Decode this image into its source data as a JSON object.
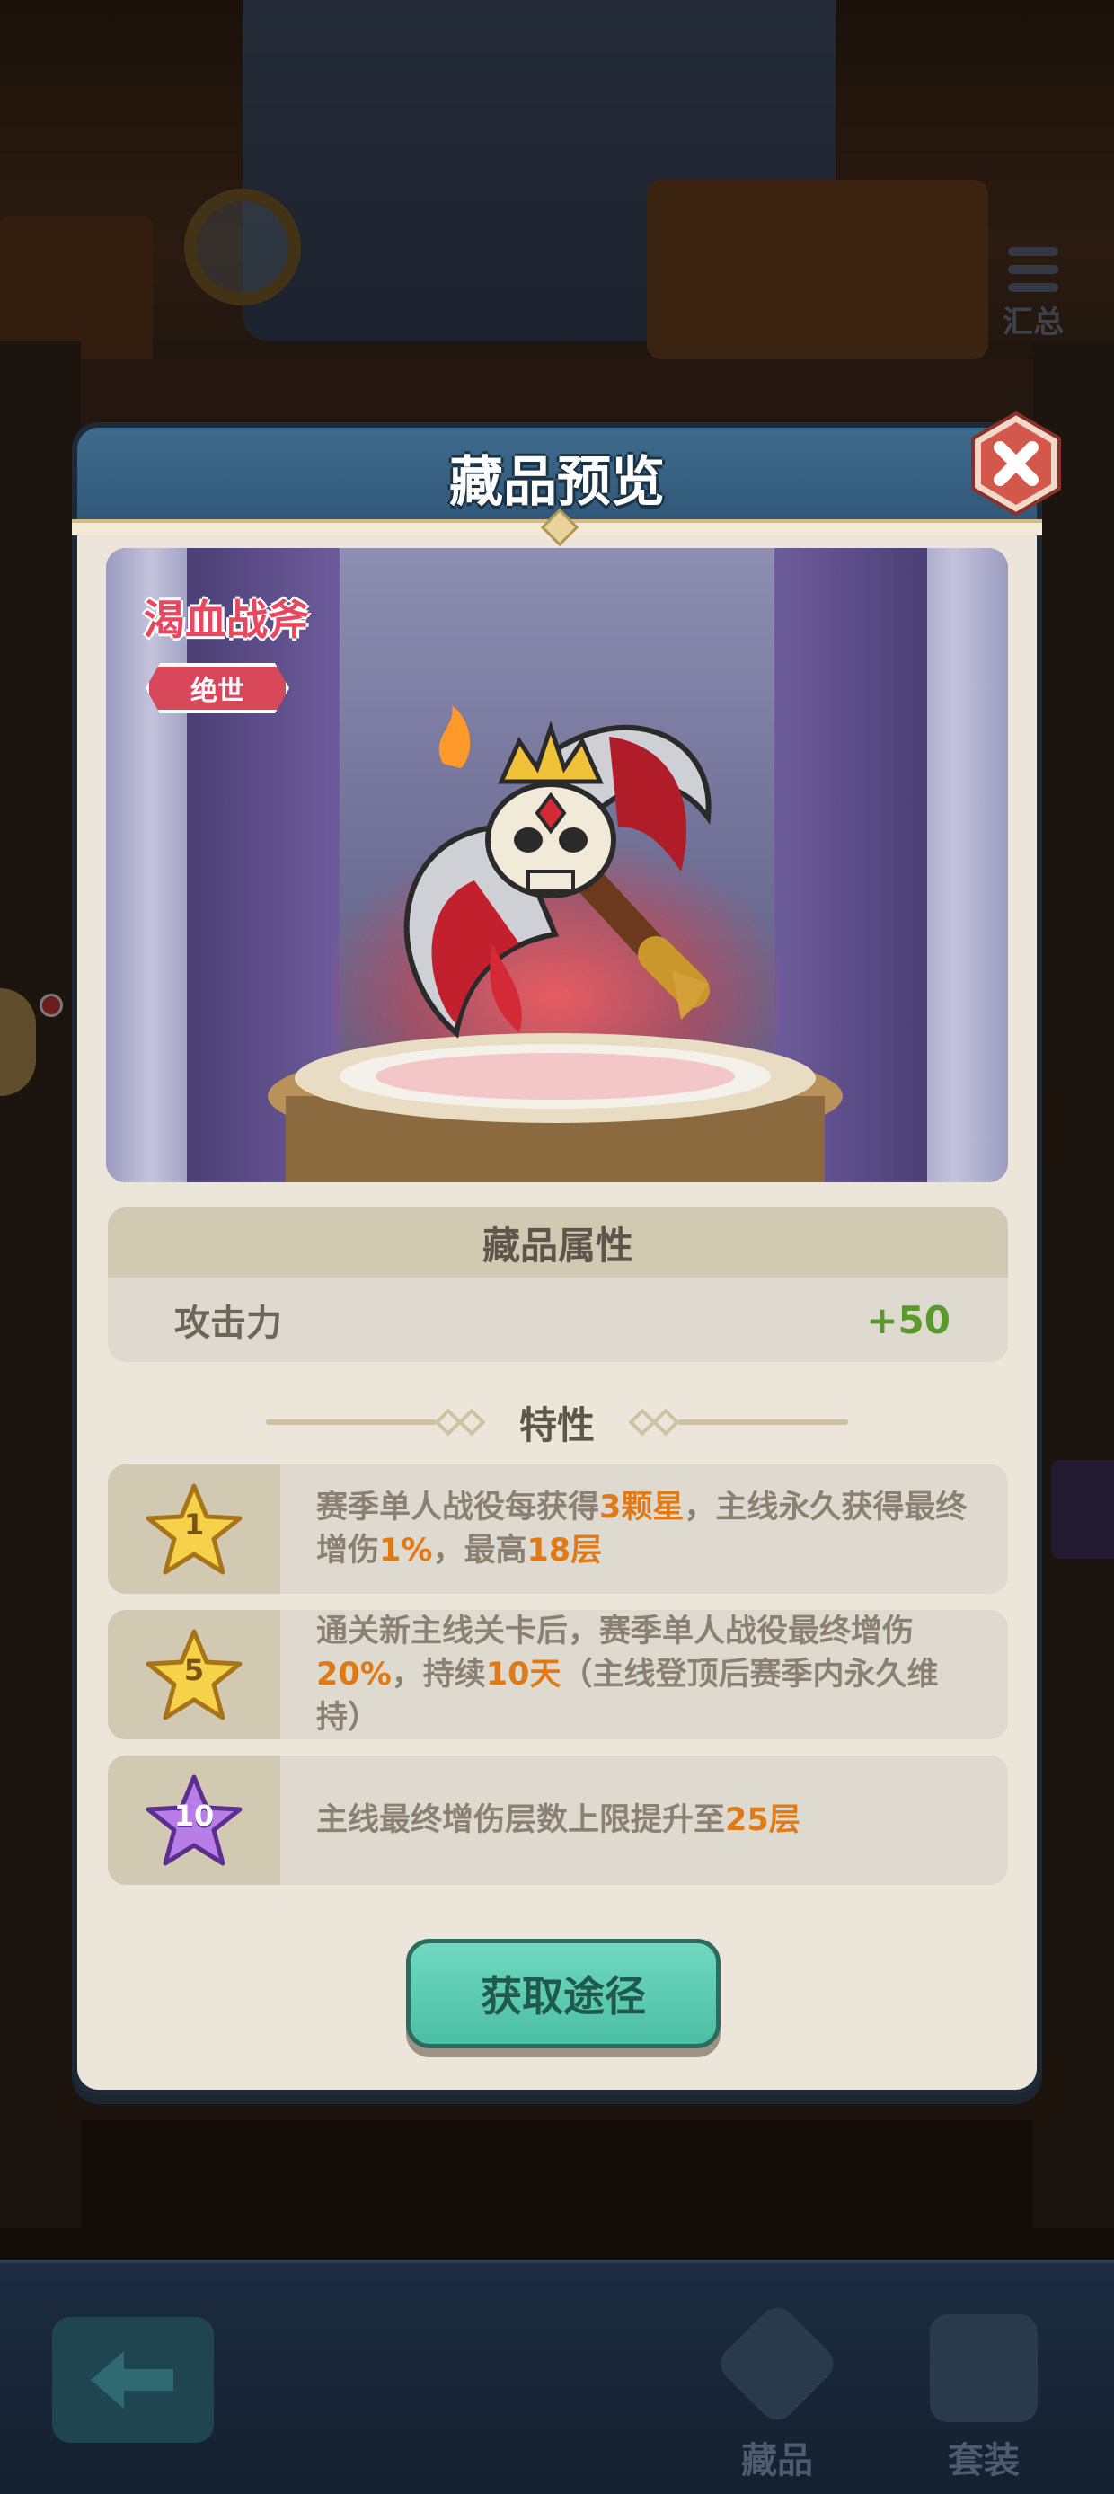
{
  "background": {
    "summary_label": "汇总"
  },
  "modal": {
    "title": "藏品预览",
    "item": {
      "name": "渴血战斧",
      "rarity": "绝世"
    },
    "attributes": {
      "header": "藏品属性",
      "rows": [
        {
          "name": "攻击力",
          "value": "+50"
        }
      ]
    },
    "traits_title": "特性",
    "traits": [
      {
        "star": "1",
        "star_color": "gold",
        "segments": [
          {
            "t": "赛季单人战役每获得",
            "hl": false
          },
          {
            "t": "3颗星",
            "hl": true
          },
          {
            "t": "，主线永久获得最终增伤",
            "hl": false
          },
          {
            "t": "1%",
            "hl": true
          },
          {
            "t": "，最高",
            "hl": false
          },
          {
            "t": "18层",
            "hl": true
          }
        ]
      },
      {
        "star": "5",
        "star_color": "gold",
        "segments": [
          {
            "t": "通关新主线关卡后，赛季单人战役最终增伤",
            "hl": false
          },
          {
            "t": "20%",
            "hl": true
          },
          {
            "t": "，持续",
            "hl": false
          },
          {
            "t": "10天",
            "hl": true
          },
          {
            "t": "（主线登顶后赛季内永久维持）",
            "hl": false
          }
        ]
      },
      {
        "star": "10",
        "star_color": "purple",
        "segments": [
          {
            "t": "主线最终增伤层数上限提升至",
            "hl": false
          },
          {
            "t": "25层",
            "hl": true
          }
        ]
      }
    ],
    "acquire_button": "获取途径"
  },
  "bottom_bar": {
    "tabs": [
      {
        "label": "藏品",
        "icon": "collection-icon"
      },
      {
        "label": "套装",
        "icon": "suit-book-icon"
      }
    ],
    "back_icon": "back-arrow-icon"
  },
  "colors": {
    "highlight": "#e07a16",
    "attr_value": "#5a9a2c",
    "item_name": "#e8475f",
    "acquire_button": "#4cbfa3",
    "header_blue": "#2f5677"
  }
}
